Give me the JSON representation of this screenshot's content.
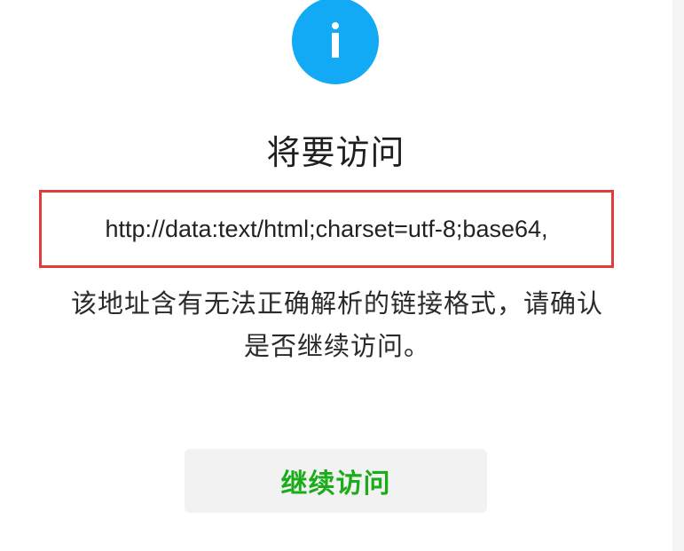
{
  "dialog": {
    "title": "将要访问",
    "url": "http://data:text/html;charset=utf-8;base64,",
    "message": "该地址含有无法正确解析的链接格式，请确认是否继续访问。",
    "continue_label": "继续访问"
  },
  "icons": {
    "info": "info-icon"
  },
  "colors": {
    "info_icon": "#12a9f5",
    "url_border": "#e03c3c",
    "continue_text": "#1aad19",
    "button_bg": "#f2f2f2"
  }
}
